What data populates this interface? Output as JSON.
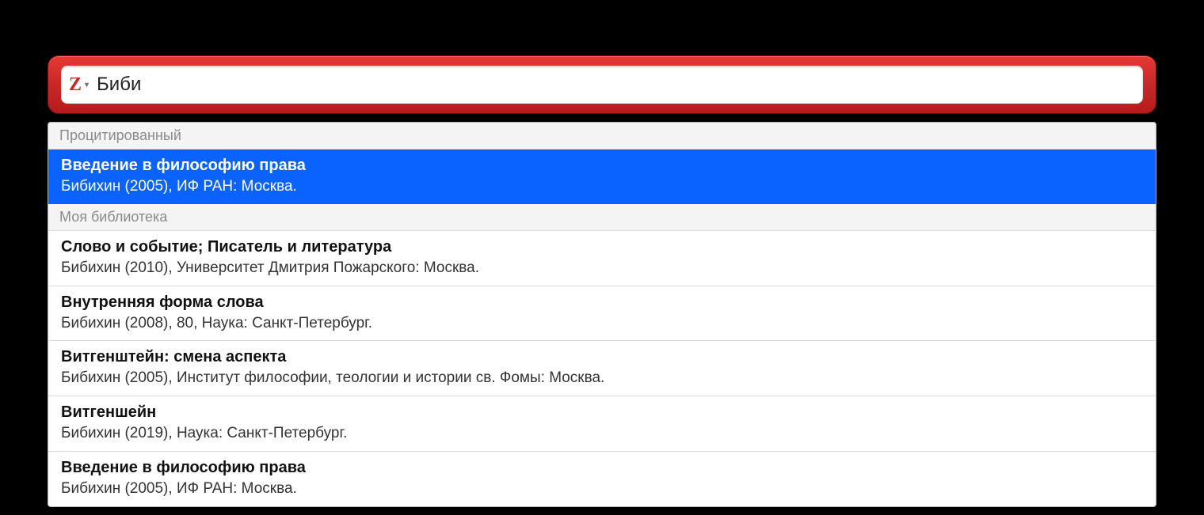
{
  "search": {
    "icon_letter": "Z",
    "value": "Биби"
  },
  "sections": [
    {
      "label": "Процитированный",
      "items": [
        {
          "title": "Введение в философию права",
          "meta": "Бибихин (2005), ИФ РАН: Москва.",
          "selected": true
        }
      ]
    },
    {
      "label": "Моя библиотека",
      "items": [
        {
          "title": "Слово и событие; Писатель и литература",
          "meta": "Бибихин (2010), Университет Дмитрия Пожарского: Москва.",
          "selected": false
        },
        {
          "title": "Внутренняя форма слова",
          "meta": "Бибихин (2008), 80, Наука: Санкт-Петербург.",
          "selected": false
        },
        {
          "title": "Витгенштейн: смена аспекта",
          "meta": "Бибихин (2005), Институт философии, теологии и истории св. Фомы: Москва.",
          "selected": false
        },
        {
          "title": "Витгеншейн",
          "meta": "Бибихин (2019), Наука: Санкт-Петербург.",
          "selected": false
        },
        {
          "title": "Введение в философию права",
          "meta": "Бибихин (2005), ИФ РАН: Москва.",
          "selected": false
        }
      ]
    }
  ]
}
